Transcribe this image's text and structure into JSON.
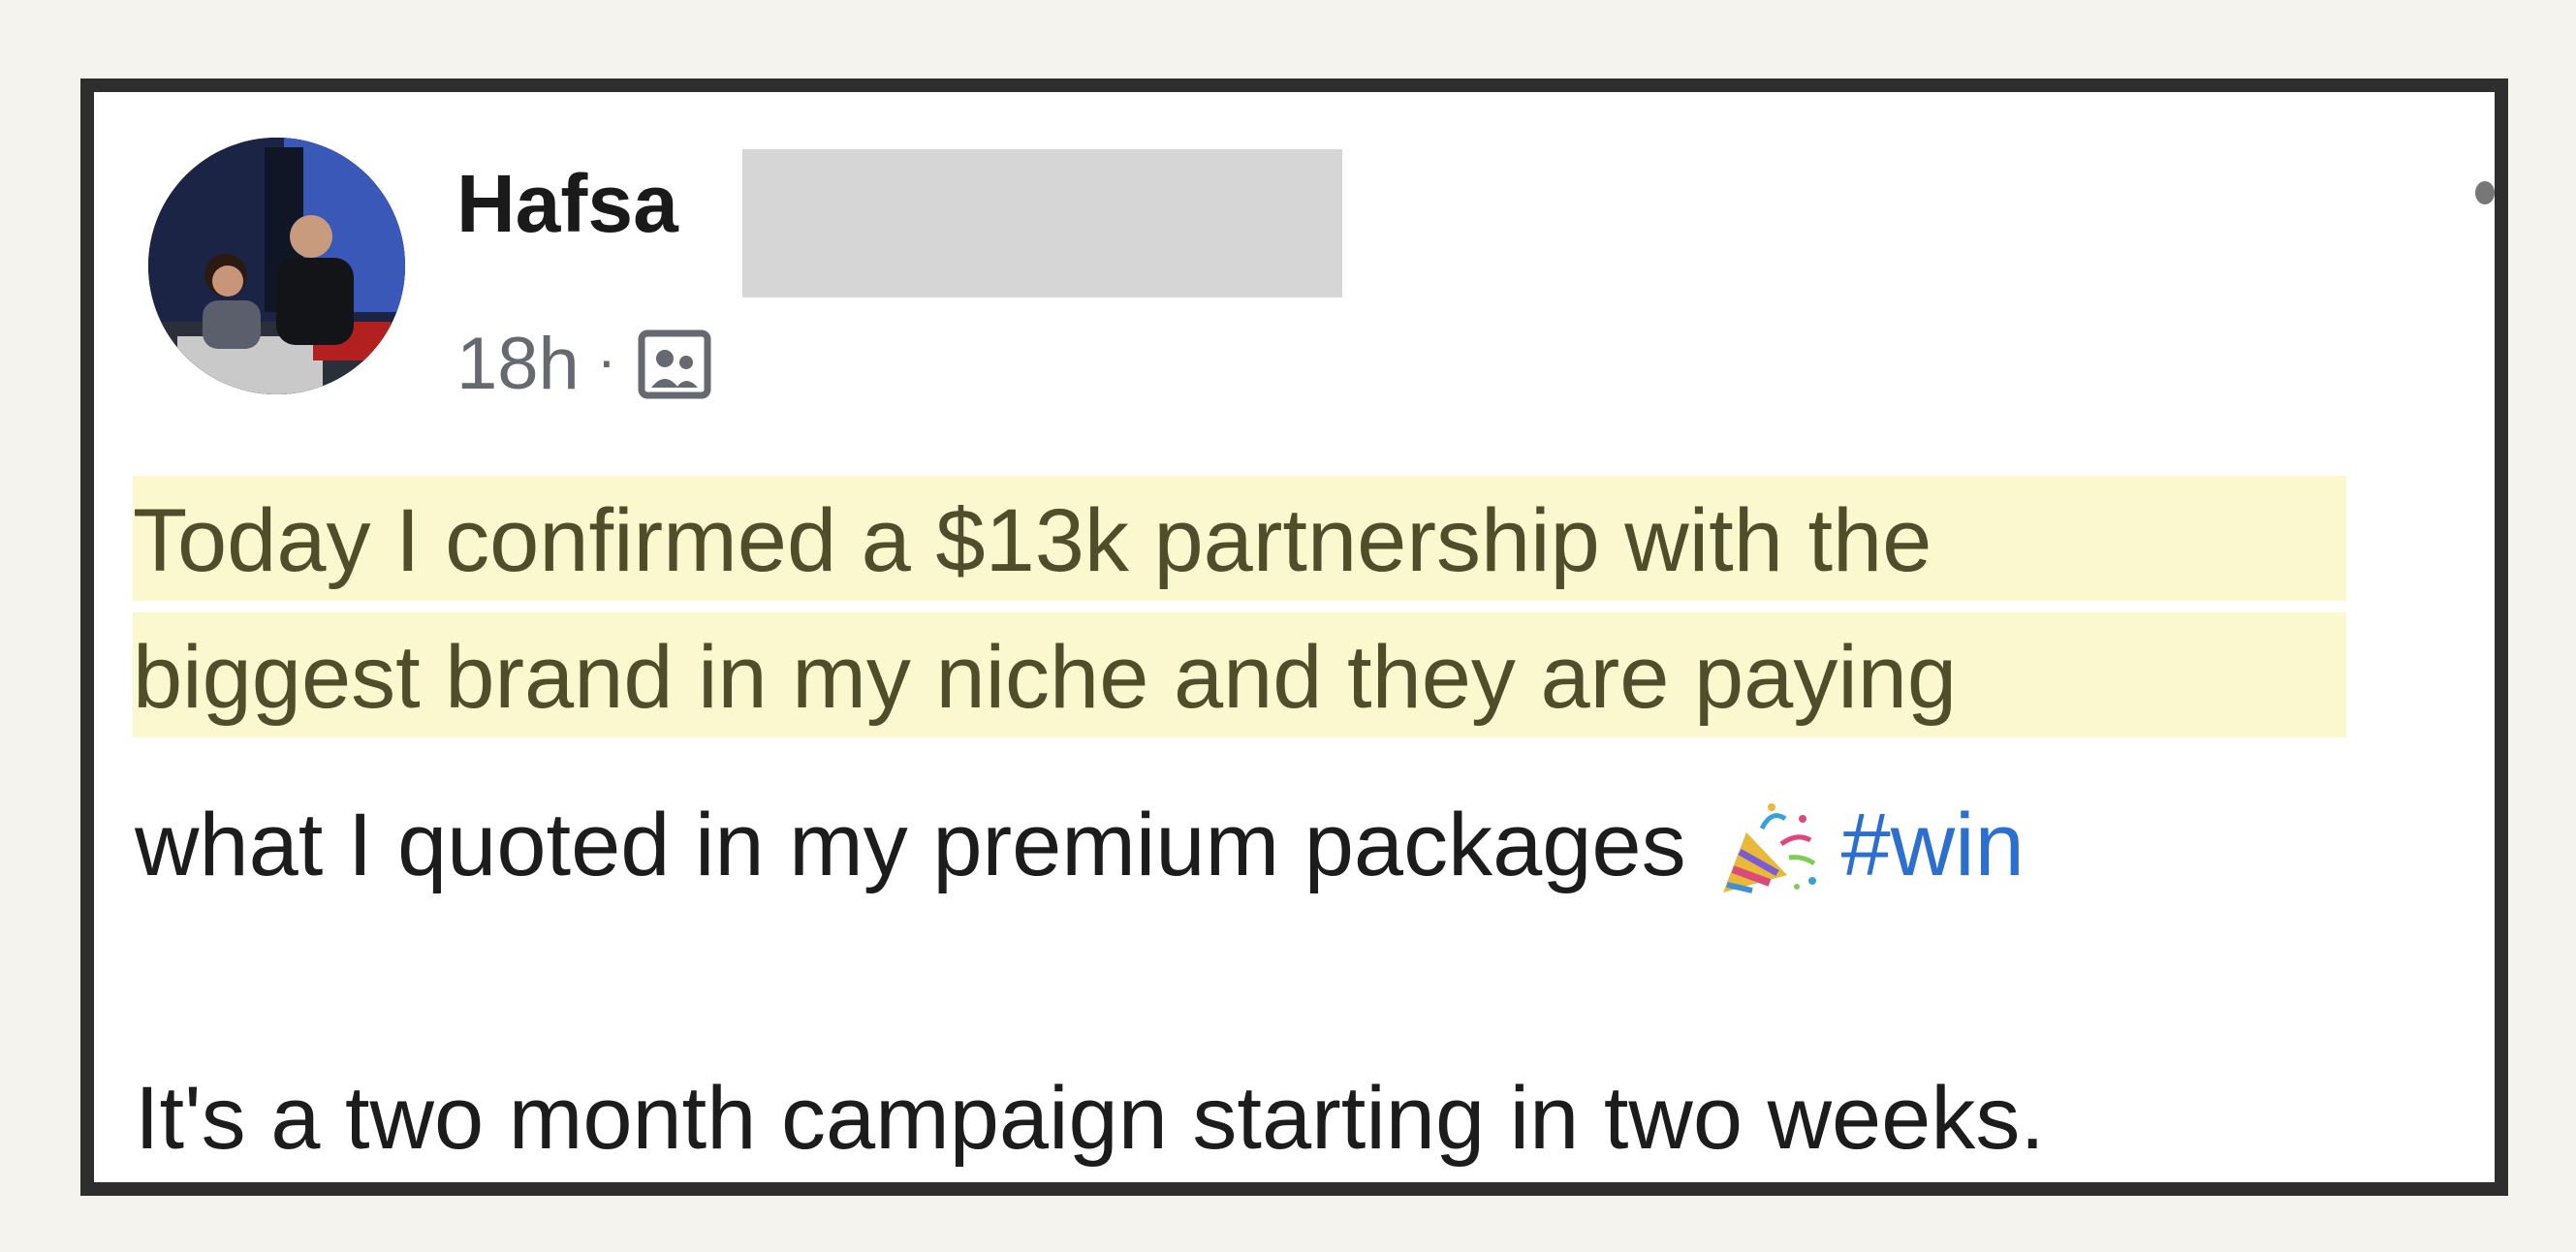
{
  "post": {
    "author_first_name": "Hafsa",
    "timestamp": "18h",
    "separator": "·",
    "audience_icon": "friends-audience-icon",
    "lines": {
      "line1": "Today I confirmed a $13k partnership with the",
      "line2": "biggest brand in my niche and they are paying",
      "line3": "what I quoted in my premium packages",
      "line3_emoji": "party-popper-emoji",
      "line3_hashtag": "#win",
      "line4": "It's a two month campaign starting in two weeks."
    }
  },
  "colors": {
    "highlight": "#fbf7cf",
    "hashtag": "#2d6fcf",
    "frame_border": "#2e2e2e",
    "redaction": "#d6d6d6"
  }
}
